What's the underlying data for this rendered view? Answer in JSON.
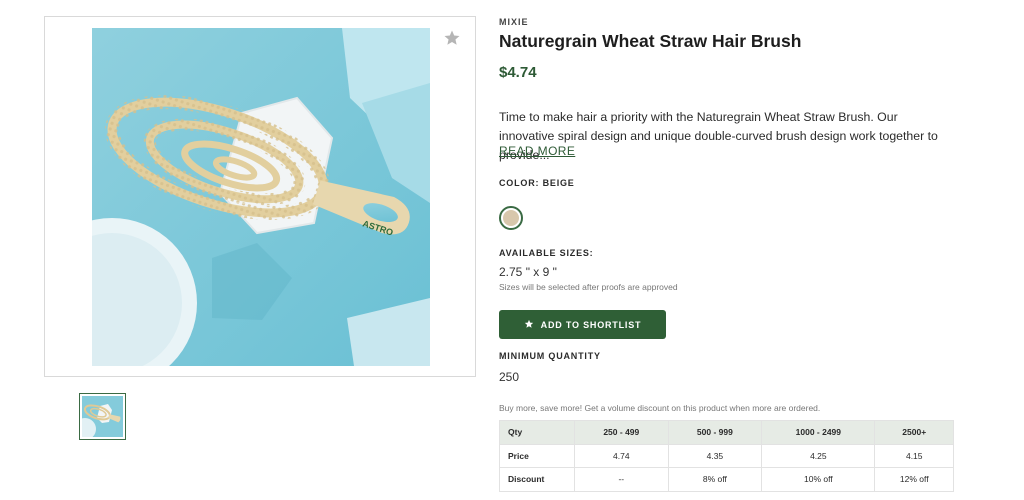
{
  "product": {
    "brand": "MIXIE",
    "title": "Naturegrain Wheat Straw Hair Brush",
    "price": "$4.74",
    "description": "Time to make hair a priority with the Naturegrain Wheat Straw Brush. Our innovative spiral design and unique double-curved brush design work together to provide...",
    "read_more": "READ MORE",
    "brush_logo_text": "ASTRO"
  },
  "color": {
    "label": "COLOR: BEIGE",
    "swatch_hex": "#d8c7ac"
  },
  "sizes": {
    "label": "AVAILABLE SIZES:",
    "value": "2.75 \" x 9 \"",
    "note": "Sizes will be selected after proofs are approved"
  },
  "shortlist": {
    "label": "ADD TO SHORTLIST"
  },
  "minimum_quantity": {
    "label": "MINIMUM QUANTITY",
    "value": "250"
  },
  "volume_note": "Buy more, save more! Get a volume discount on this product when more are ordered.",
  "pricing_table": {
    "headers": [
      "Qty",
      "250 - 499",
      "500 - 999",
      "1000 - 2499",
      "2500+"
    ],
    "price_row": [
      "Price",
      "4.74",
      "4.35",
      "4.25",
      "4.15"
    ],
    "discount_row": [
      "Discount",
      "--",
      "8% off",
      "10% off",
      "12% off"
    ]
  },
  "colors": {
    "accent": "#2d5a35",
    "button_bg": "#2f5f36",
    "table_header_bg": "#e6ebe5"
  },
  "icons": {
    "favorite": "star-icon",
    "button": "star-icon"
  }
}
